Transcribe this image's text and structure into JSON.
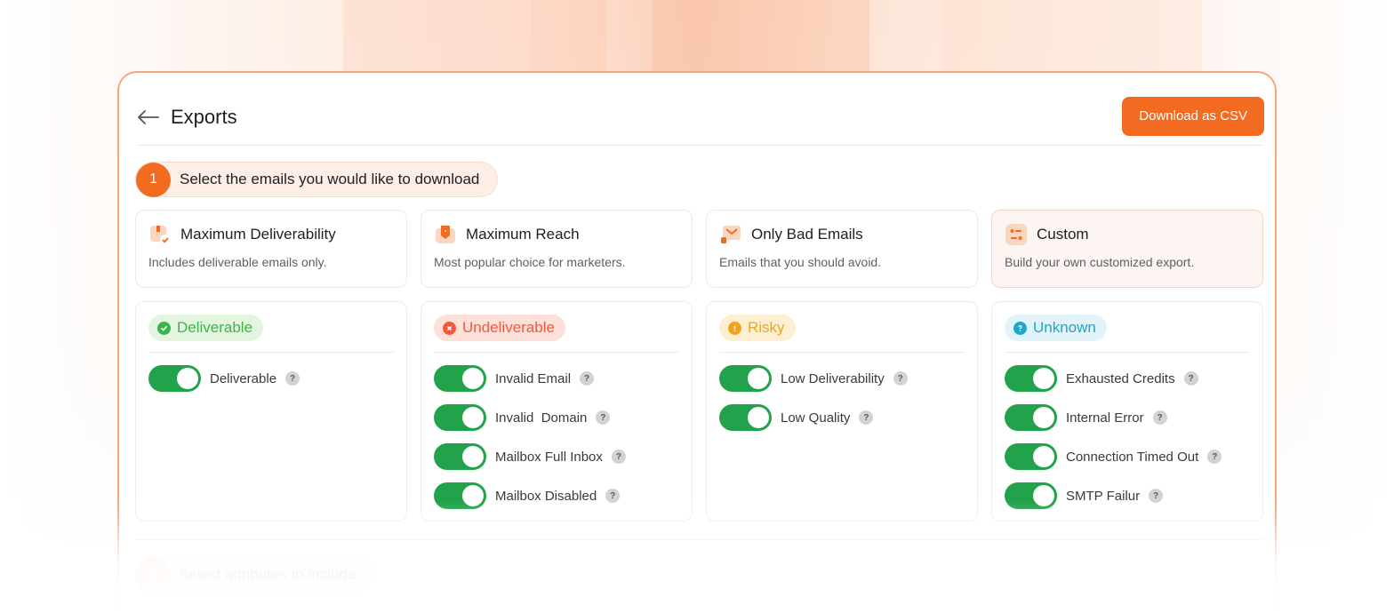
{
  "header": {
    "title": "Exports",
    "download_button": "Download as CSV"
  },
  "step1": {
    "number": "1",
    "label": "Select the emails you would like to download"
  },
  "presets": [
    {
      "title": "Maximum Deliverability",
      "description": "Includes deliverable emails only.",
      "icon": "deliverability-icon",
      "active": false
    },
    {
      "title": "Maximum Reach",
      "description": "Most popular choice for marketers.",
      "icon": "reach-icon",
      "active": false
    },
    {
      "title": "Only Bad Emails",
      "description": "Emails that you should avoid.",
      "icon": "bad-emails-icon",
      "active": false
    },
    {
      "title": "Custom",
      "description": "Build your own customized export.",
      "icon": "custom-icon",
      "active": true
    }
  ],
  "categories": [
    {
      "badge": "Deliverable",
      "badge_color": "#3bb54a",
      "badge_bg": "#e4f5df",
      "icon": "check-circle-icon",
      "options": [
        {
          "label": "Deliverable",
          "on": true
        }
      ]
    },
    {
      "badge": "Undeliverable",
      "badge_color": "#ef5a3c",
      "badge_bg": "#fde0d9",
      "icon": "x-circle-icon",
      "options": [
        {
          "label": "Invalid Email",
          "on": true
        },
        {
          "label": "Invalid  Domain",
          "on": true
        },
        {
          "label": "Mailbox Full Inbox",
          "on": true
        },
        {
          "label": "Mailbox Disabled",
          "on": true
        }
      ]
    },
    {
      "badge": "Risky",
      "badge_color": "#f2a41f",
      "badge_bg": "#fdf0d2",
      "icon": "warning-circle-icon",
      "options": [
        {
          "label": "Low Deliverability",
          "on": true
        },
        {
          "label": "Low Quality",
          "on": true
        }
      ]
    },
    {
      "badge": "Unknown",
      "badge_color": "#1fa6c8",
      "badge_bg": "#e2f4f9",
      "icon": "question-circle-icon",
      "options": [
        {
          "label": "Exhausted Credits",
          "on": true
        },
        {
          "label": "Internal Error",
          "on": true
        },
        {
          "label": "Connection Timed Out",
          "on": true
        },
        {
          "label": "SMTP Failur",
          "on": true
        }
      ]
    }
  ],
  "step2": {
    "number": "2",
    "label": "Select attributes to include"
  },
  "colors": {
    "accent": "#f26b21",
    "toggle_on": "#22a24a"
  }
}
